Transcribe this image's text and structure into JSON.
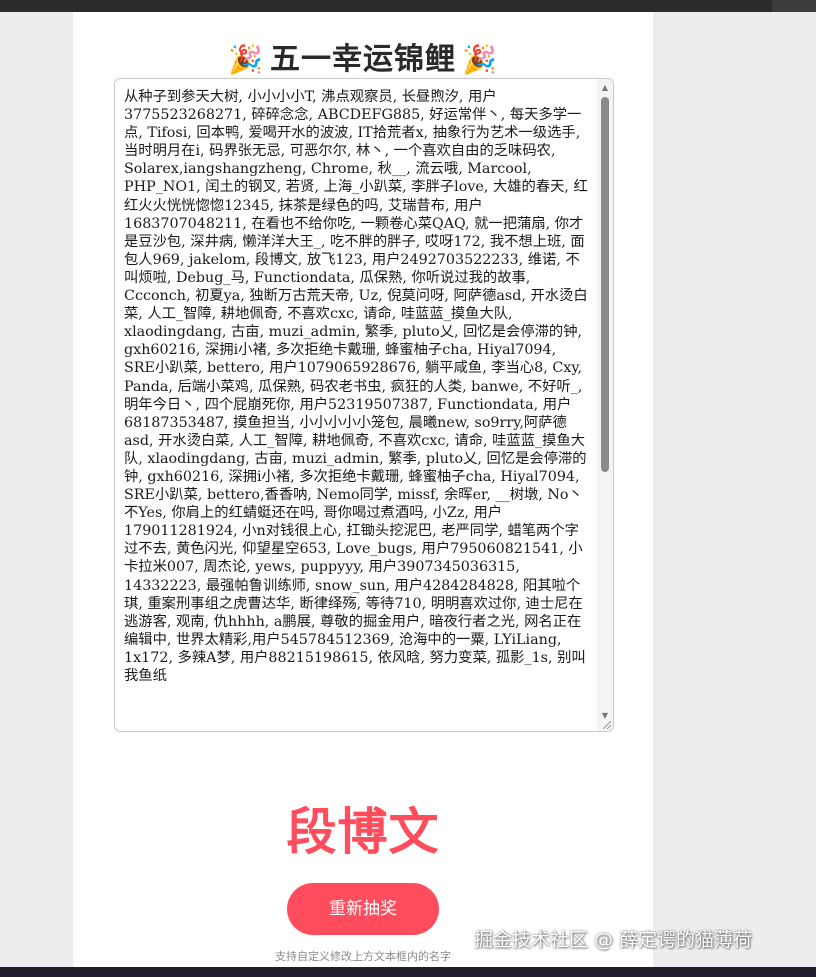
{
  "title": {
    "text": "五一幸运锦鲤",
    "left_emoji": "🎉",
    "right_emoji": "🎉"
  },
  "names_text": "从种子到参天大树, 小小小小T, 沸点观察员, 长昼煦汐, 用户3775523268271, 碎碎念念, ABCDEFG885, 好运常伴丶, 每天多学一点, Tifosi, 回本鸭, 爱喝开水的波波, IT拾荒者x, 抽象行为艺术一级选手, 当时明月在i, 码界张无忌, 可恶尔尔, 林丶, 一个喜欢自由的乏味码农, Solarex,iangshangzheng, Chrome, 秋__, 流云哦, Marcool, PHP_NO1, 闰土的钢叉, 若贤, 上海_小趴菜, 李胖子love, 大雄的春天, 红红火火恍恍惚惚12345, 抹茶是绿色的吗, 艾瑞昔布, 用户1683707048211, 在看也不给你吃, 一颗卷心菜QAQ, 就一把蒲扇, 你才是豆沙包, 深井病, 懒洋洋大王_, 吃不胖的胖子, 哎呀172, 我不想上班, 面包人969, jakelom, 段博文, 放飞123, 用户2492703522233, 维诺, 不叫烦啦, Debug_马, Functiondata, 瓜保熟, 你听说过我的故事, Ccconch, 初夏ya, 独断万古荒天帝, Uz, 倪莫问呀, 阿萨德asd, 开水烫白菜, 人工_智障, 耕地佩奇, 不喜欢cxc, 请命, 哇蓝蓝_摸鱼大队, xlaodingdang, 古亩, muzi_admin, 繁季, pluto乂, 回忆是会停滞的钟, gxh60216, 深拥i小褚, 多次拒绝卡戴珊, 蜂蜜柚子cha, Hiyal7094, SRE小趴菜, bettero, 用户1079065928676, 躺平咸鱼, 李当心8, Cxy, Panda, 后端小菜鸡, 瓜保熟, 码农老书虫, 疯狂的人类, banwe, 不好听_, 明年今日丶, 四个屁崩死你, 用户52319507387, Functiondata, 用户68187353487, 摸鱼担当, 小小小小小笼包, 晨曦new, so9rry,阿萨德asd, 开水烫白菜, 人工_智障, 耕地佩奇, 不喜欢cxc, 请命, 哇蓝蓝_摸鱼大队, xlaodingdang, 古亩, muzi_admin, 繁季, pluto乂, 回忆是会停滞的钟, gxh60216, 深拥i小褚, 多次拒绝卡戴珊, 蜂蜜柚子cha, Hiyal7094, SRE小趴菜, bettero,香香呐, Nemo同学, missf, 余晖er, __树墩, No丶不Yes, 你肩上的红蜻蜓还在吗, 哥你喝过煮酒吗, 小Zz, 用户179011281924, 小n对钱很上心, 扛锄头挖泥巴, 老严同学, 蜡笔两个字过不去, 黄色闪光, 仰望星空653, Love_bugs, 用户795060821541, 小卡拉米007, 周杰论, yews, puppyyy, 用户3907345036315, 14332223, 最强帕鲁训练师, snow_sun, 用户4284284828, 阳其啦个琪, 重案刑事组之虎曹达华, 断律绎殇, 等待710, 明明喜欢过你, 迪士尼在逃游客, 观南, 仇hhhh, a鹏展, 尊敬的掘金用户, 暗夜行者之光, 网名正在编辑中, 世界太精彩,用户545784512369, 沧海中的一粟, LYiLiang, 1x172, 多辣A梦, 用户88215198615, 依风晗, 努力变菜, 孤影_1s, 别叫我鱼纸",
  "winner": "段博文",
  "redraw_label": "重新抽奖",
  "hint": "支持自定义修改上方文本框内的名字",
  "watermark": "掘金技术社区 @ 薛定谔的猫薄荷",
  "colors": {
    "accent": "#ff4d5e",
    "title": "#2a2a2a",
    "background": "#ededed"
  }
}
